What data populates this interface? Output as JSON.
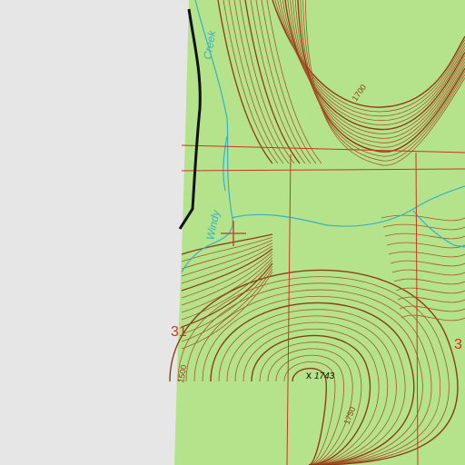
{
  "map": {
    "colors": {
      "background_gray": "#e6e6e6",
      "forest_green": "#b5e38b",
      "contour_brown": "#a5582a",
      "index_contour_brown": "#8d3c16",
      "stream_cyan": "#35b2c4",
      "section_line_red": "#cc3322",
      "road_black": "#111111",
      "grid_gray": "#808080"
    },
    "labels": {
      "creek_word_1": "Creek",
      "creek_word_2": "Windy",
      "contour_1700": "1700",
      "contour_1500": "1500",
      "contour_1750": "1750",
      "spot_elevation": "1743",
      "section_left": "31",
      "section_right": "3"
    },
    "symbols": {
      "summit_marker": "x",
      "feature_marker": "crosshair"
    }
  }
}
